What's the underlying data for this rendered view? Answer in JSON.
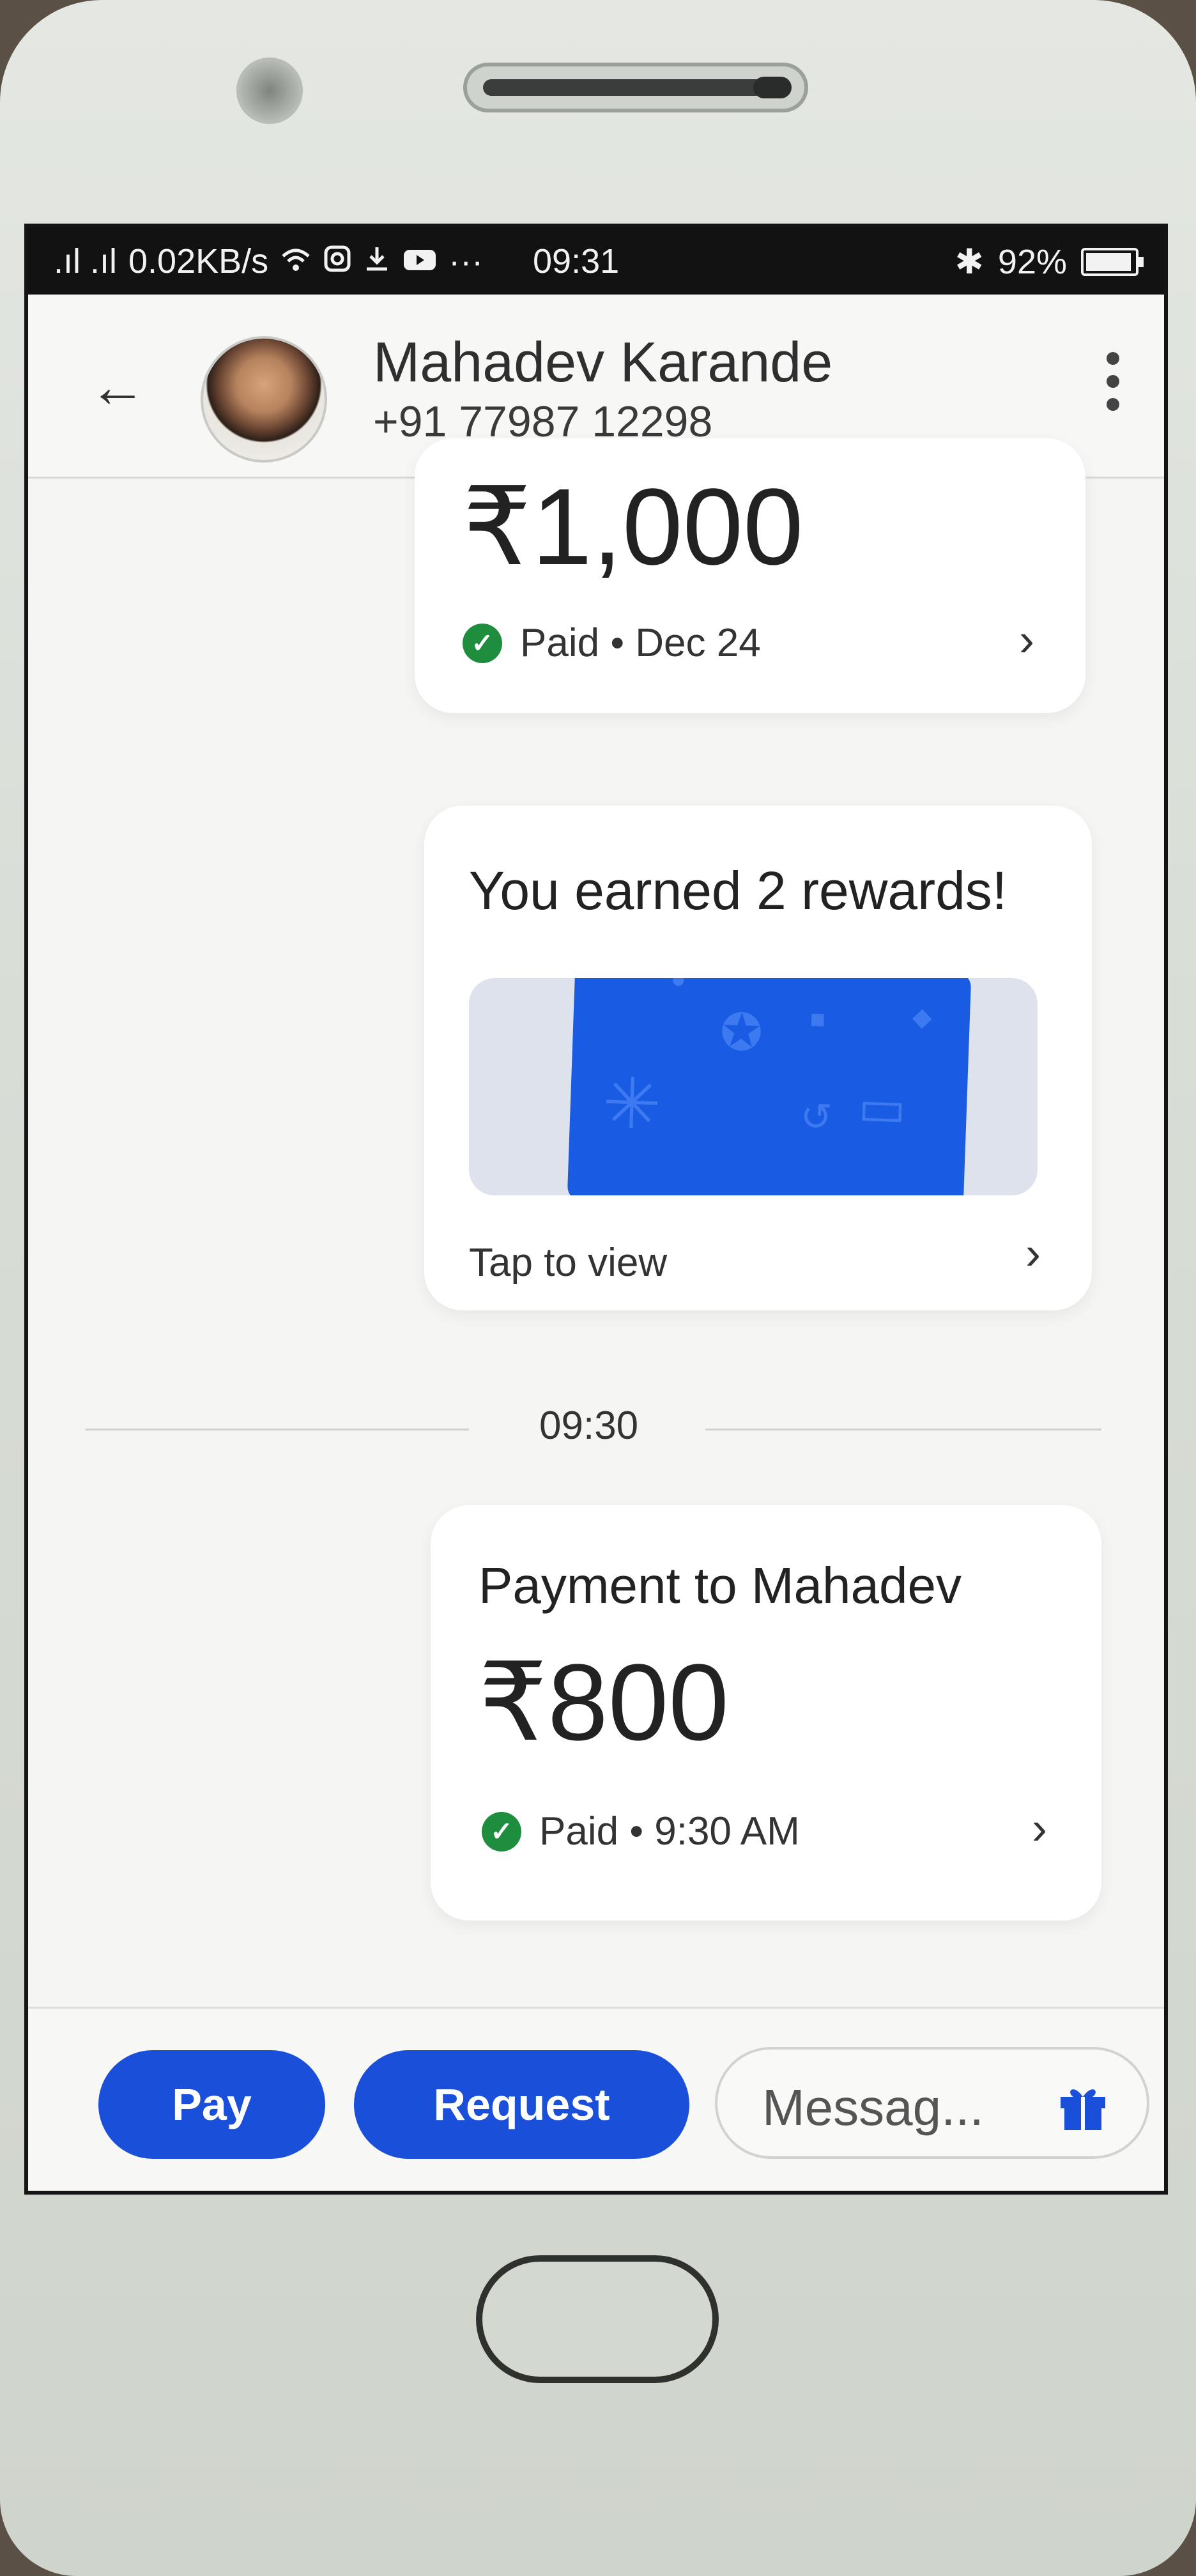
{
  "status_bar": {
    "network": ".ıl .ıl",
    "speed": "0.02KB/s",
    "notification_icons": [
      "wifi-icon",
      "instagram-icon",
      "download-icon",
      "youtube-icon"
    ],
    "more_indicator": "···",
    "time": "09:31",
    "bluetooth": "✱",
    "battery": "92%"
  },
  "header": {
    "back_icon": "←",
    "contact_name": "Mahadev Karande",
    "contact_phone": "+91 77987 12298"
  },
  "messages": {
    "payment1": {
      "amount": "₹1,000",
      "status": "Paid • Dec 24"
    },
    "reward": {
      "title": "You earned 2 rewards!",
      "action": "Tap to view"
    },
    "time_divider": "09:30",
    "payment2": {
      "title": "Payment to Mahadev",
      "amount": "₹800",
      "status": "Paid • 9:30 AM"
    }
  },
  "bottom_bar": {
    "pay_label": "Pay",
    "request_label": "Request",
    "message_placeholder": "Messag...",
    "gift_icon": "gift-icon"
  },
  "colors": {
    "primary": "#1a4fd9",
    "paid_green": "#1e8e3e",
    "reward_card": "#1a5be3"
  }
}
